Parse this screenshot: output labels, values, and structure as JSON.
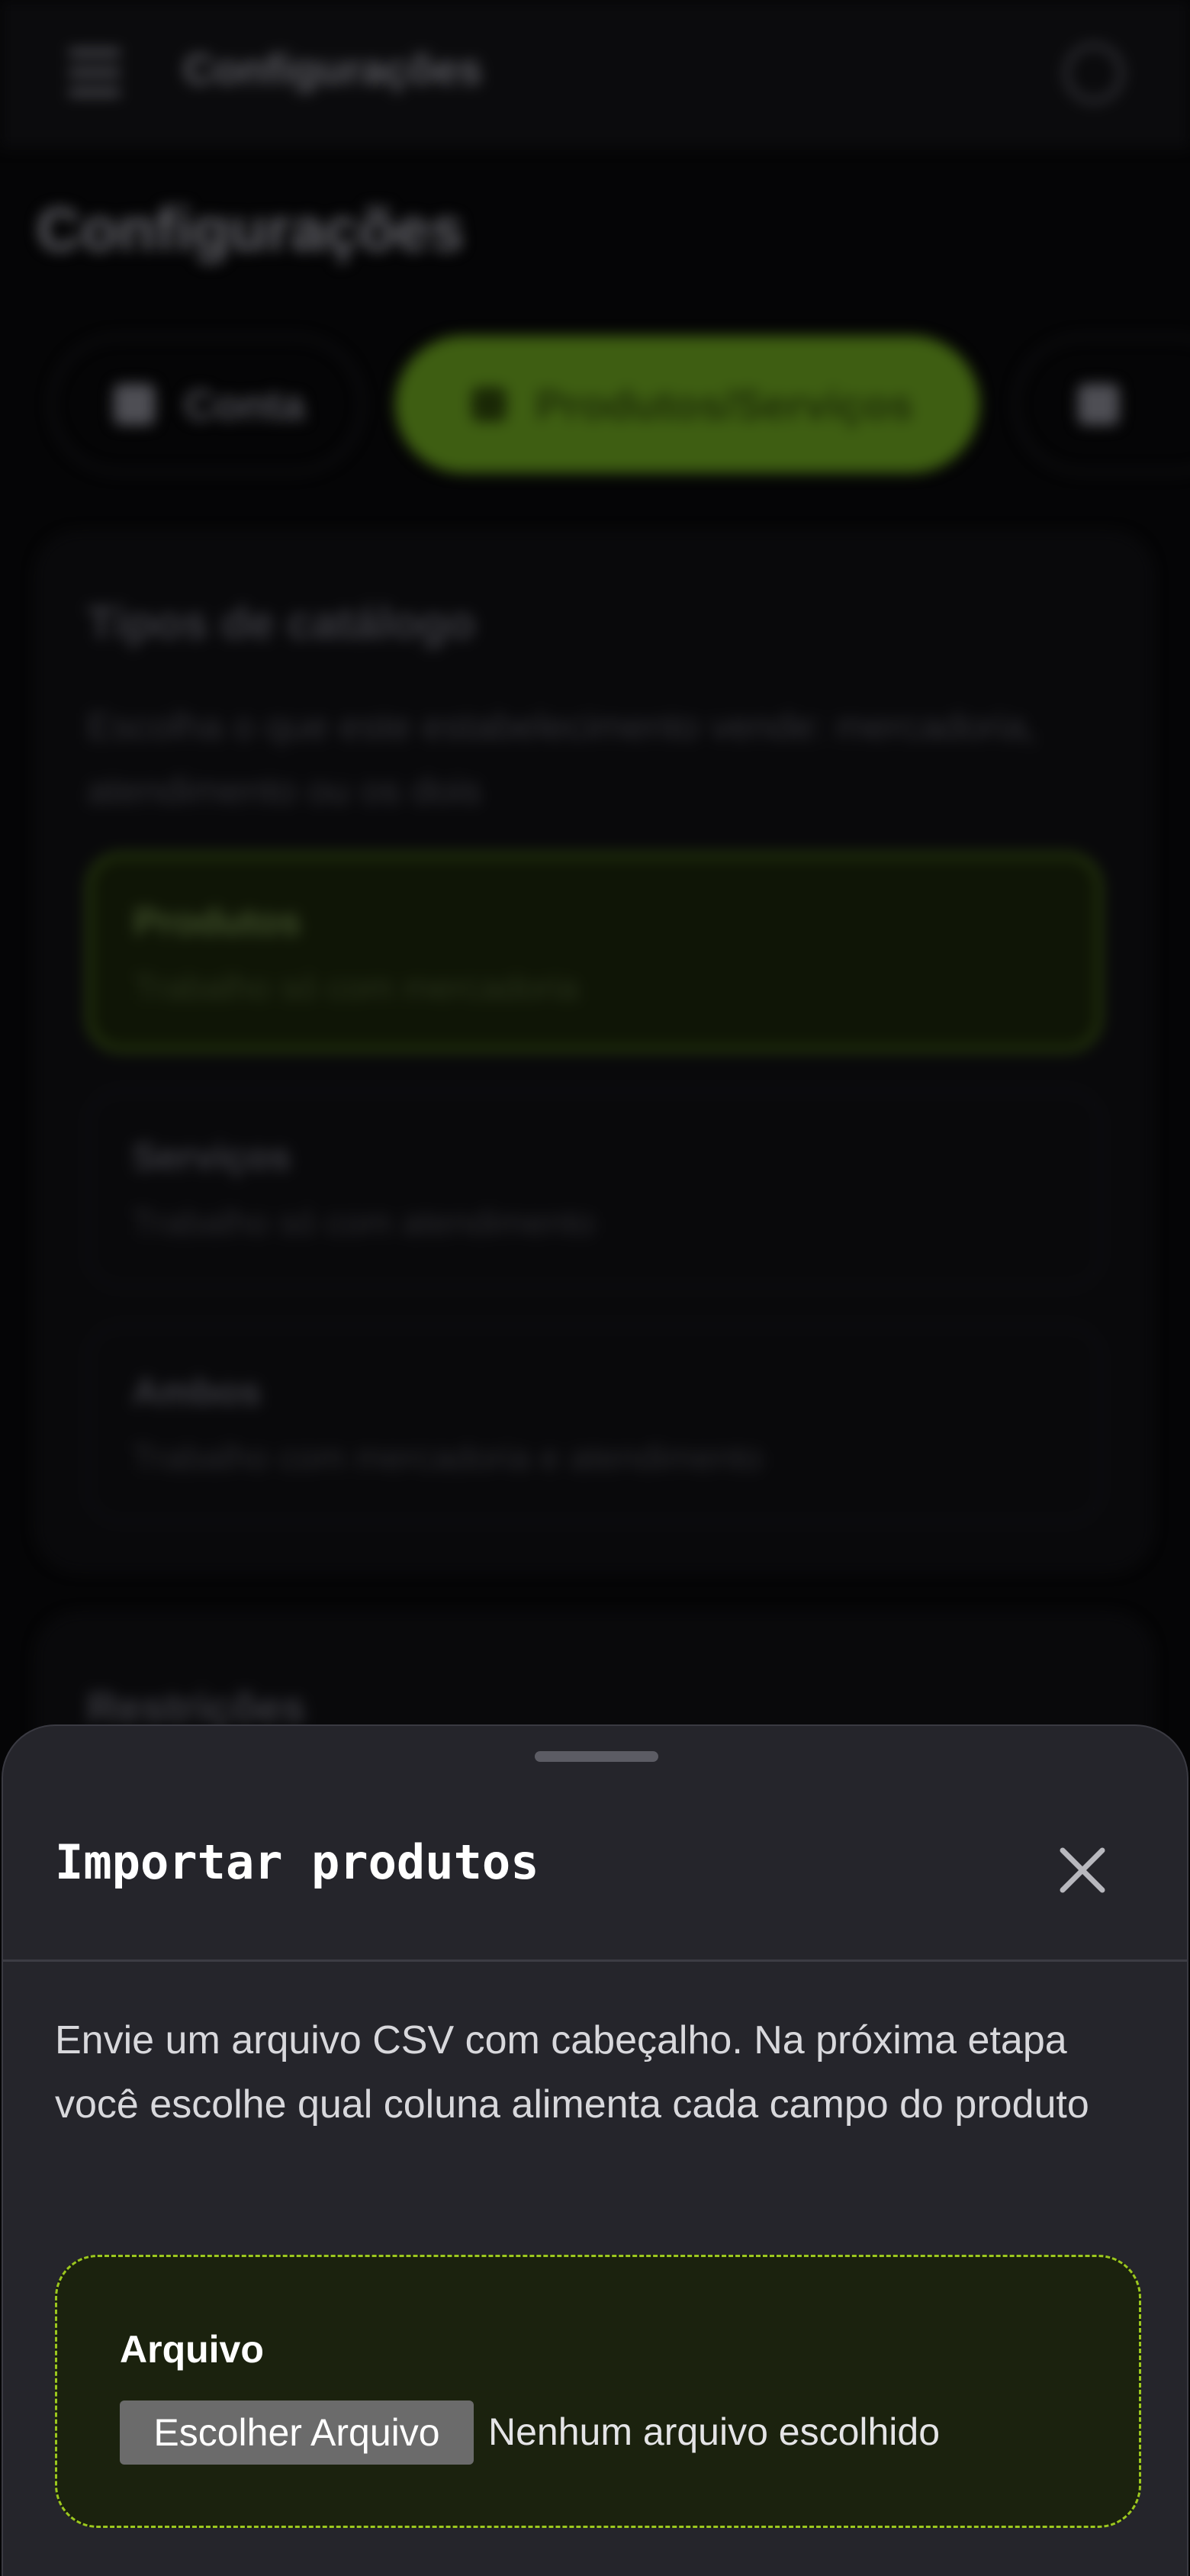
{
  "header": {
    "title": "Configurações"
  },
  "page": {
    "title": "Configurações"
  },
  "tabs": [
    {
      "label": "Conta",
      "icon": "user-icon"
    },
    {
      "label": "Produtos/Serviços",
      "icon": "box-icon",
      "active": true
    },
    {
      "label": "",
      "icon": "phone-icon"
    }
  ],
  "catalog_card": {
    "title": "Tipos de catálogo",
    "description": "Escolha o que este estabelecimento vende: mercadoria, atendimento ou os dois",
    "options": [
      {
        "title": "Produtos",
        "subtitle": "Trabalho só com mercadoria",
        "selected": true
      },
      {
        "title": "Serviços",
        "subtitle": "Trabalho só com atendimento",
        "selected": false
      },
      {
        "title": "Ambos",
        "subtitle": "Trabalho com mercadoria e atendimento",
        "selected": false
      }
    ]
  },
  "second_card": {
    "title": "Restrições"
  },
  "modal": {
    "title": "Importar produtos",
    "description": "Envie um arquivo CSV com cabeçalho. Na próxima etapa você escolhe qual coluna alimenta cada campo do produto",
    "file_label": "Arquivo",
    "file_button": "Escolher Arquivo",
    "file_status": "Nenhum arquivo escolhido",
    "close_icon": "close-icon"
  },
  "colors": {
    "accent": "#9cc81e",
    "sheet_bg": "#25252b",
    "dropzone_bg": "#1b220e"
  }
}
